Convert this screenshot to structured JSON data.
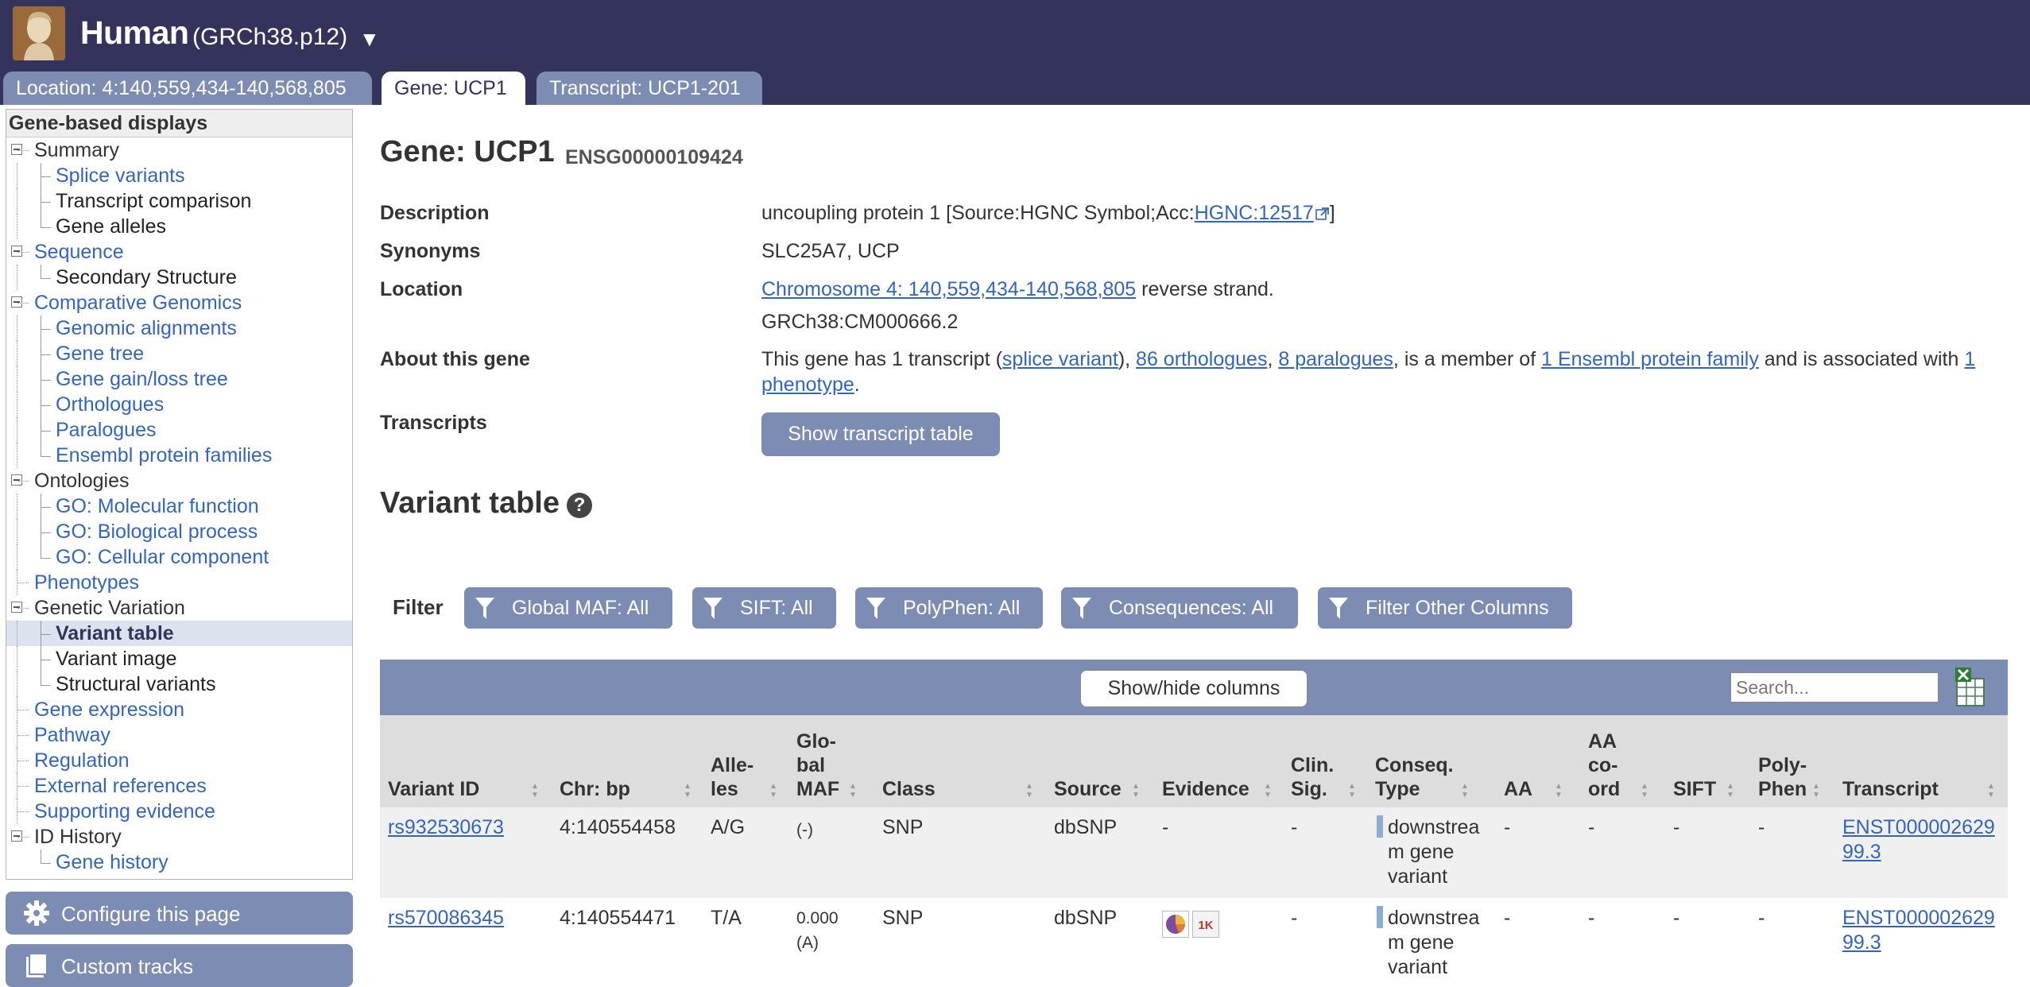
{
  "header": {
    "species": "Human",
    "assembly": "(GRCh38.p12)",
    "dropdown_glyph": "▼",
    "tabs": [
      {
        "label": "Location: 4:140,559,434-140,568,805"
      },
      {
        "label": "Gene: UCP1"
      },
      {
        "label": "Transcript: UCP1-201"
      }
    ]
  },
  "sidebar": {
    "heading": "Gene-based displays",
    "items": [
      {
        "label": "Summary"
      },
      {
        "label": "Splice variants"
      },
      {
        "label": "Transcript comparison"
      },
      {
        "label": "Gene alleles"
      },
      {
        "label": "Sequence"
      },
      {
        "label": "Secondary Structure"
      },
      {
        "label": "Comparative Genomics"
      },
      {
        "label": "Genomic alignments"
      },
      {
        "label": "Gene tree"
      },
      {
        "label": "Gene gain/loss tree"
      },
      {
        "label": "Orthologues"
      },
      {
        "label": "Paralogues"
      },
      {
        "label": "Ensembl protein families"
      },
      {
        "label": "Ontologies"
      },
      {
        "label": "GO: Molecular function"
      },
      {
        "label": "GO: Biological process"
      },
      {
        "label": "GO: Cellular component"
      },
      {
        "label": "Phenotypes"
      },
      {
        "label": "Genetic Variation"
      },
      {
        "label": "Variant table"
      },
      {
        "label": "Variant image"
      },
      {
        "label": "Structural variants"
      },
      {
        "label": "Gene expression"
      },
      {
        "label": "Pathway"
      },
      {
        "label": "Regulation"
      },
      {
        "label": "External references"
      },
      {
        "label": "Supporting evidence"
      },
      {
        "label": "ID History"
      },
      {
        "label": "Gene history"
      }
    ],
    "buttons": {
      "configure": "Configure this page",
      "custom_tracks": "Custom tracks"
    }
  },
  "gene": {
    "title": "Gene: UCP1",
    "stable_id": "ENSG00000109424",
    "summary": {
      "description_label": "Description",
      "description_text": "uncoupling protein 1 [Source:HGNC Symbol;Acc:",
      "description_link": "HGNC:12517",
      "description_end": "]",
      "synonyms_label": "Synonyms",
      "synonyms": "SLC25A7, UCP",
      "location_label": "Location",
      "location_link": "Chromosome 4: 140,559,434-140,568,805",
      "location_strand": " reverse strand.",
      "location_assembly": "GRCh38:CM000666.2",
      "about_label": "About this gene",
      "about_1": "This gene has 1 transcript (",
      "about_link_splice": "splice variant",
      "about_2": "), ",
      "about_link_orthologues": "86 orthologues",
      "about_3": ", ",
      "about_link_paralogues": "8 paralogues",
      "about_4": ", is a member of ",
      "about_link_family": "1 Ensembl protein family",
      "about_5": " and is associated with ",
      "about_link_phenotype_1": "1",
      "about_link_phenotype_2": "phenotype",
      "about_6": ".",
      "transcripts_label": "Transcripts",
      "show_transcript_button": "Show transcript table"
    }
  },
  "variant_table": {
    "heading": "Variant table",
    "help_glyph": "?",
    "filter_label": "Filter",
    "filters": [
      {
        "label": "Global MAF: All"
      },
      {
        "label": "SIFT: All"
      },
      {
        "label": "PolyPhen: All"
      },
      {
        "label": "Consequences: All"
      },
      {
        "label": "Filter Other Columns"
      }
    ],
    "show_hide_columns": "Show/hide columns",
    "search_placeholder": "Search...",
    "columns": [
      [
        "Variant ID"
      ],
      [
        "Chr: bp"
      ],
      [
        "Alle-",
        "les"
      ],
      [
        "Glo-",
        "bal",
        "MAF"
      ],
      [
        "Class"
      ],
      [
        "Source"
      ],
      [
        "Evidence"
      ],
      [
        "Clin.",
        "Sig."
      ],
      [
        "Conseq.",
        "Type"
      ],
      [
        "AA"
      ],
      [
        "AA",
        "co-",
        "ord"
      ],
      [
        "SIFT"
      ],
      [
        "Poly-",
        "Phen"
      ],
      [
        "Transcript"
      ]
    ],
    "rows": [
      {
        "variant_id": "rs932530673",
        "chr_bp": "4:140554458",
        "alleles": "A/G",
        "maf": "(-)",
        "maf_allele": "",
        "class": "SNP",
        "source": "dbSNP",
        "evidence": "-",
        "clin_sig": "-",
        "conseq": [
          "downstrea",
          "m gene",
          "variant"
        ],
        "aa": "-",
        "aa_coord": "-",
        "sift": "-",
        "polyphen": "-",
        "transcript": [
          "ENST000002629",
          "99.3"
        ]
      },
      {
        "variant_id": "rs570086345",
        "chr_bp": "4:140554471",
        "alleles": "T/A",
        "maf": "0.000",
        "maf_allele": "(A)",
        "class": "SNP",
        "source": "dbSNP",
        "evidence_icons": [
          "frequency-pie-icon",
          "1000-genomes-icon"
        ],
        "evidence_icon_text": "1K",
        "clin_sig": "-",
        "conseq": [
          "downstrea",
          "m gene",
          "variant"
        ],
        "aa": "-",
        "aa_coord": "-",
        "sift": "-",
        "polyphen": "-",
        "transcript": [
          "ENST000002629",
          "99.3"
        ]
      }
    ]
  },
  "colors": {
    "header_bg": "#33335c",
    "tab_inactive": "#7d8cb3",
    "button_bg": "#7d8cb3",
    "link": "#3366bb",
    "conseq_bar": "#8dadd1"
  }
}
